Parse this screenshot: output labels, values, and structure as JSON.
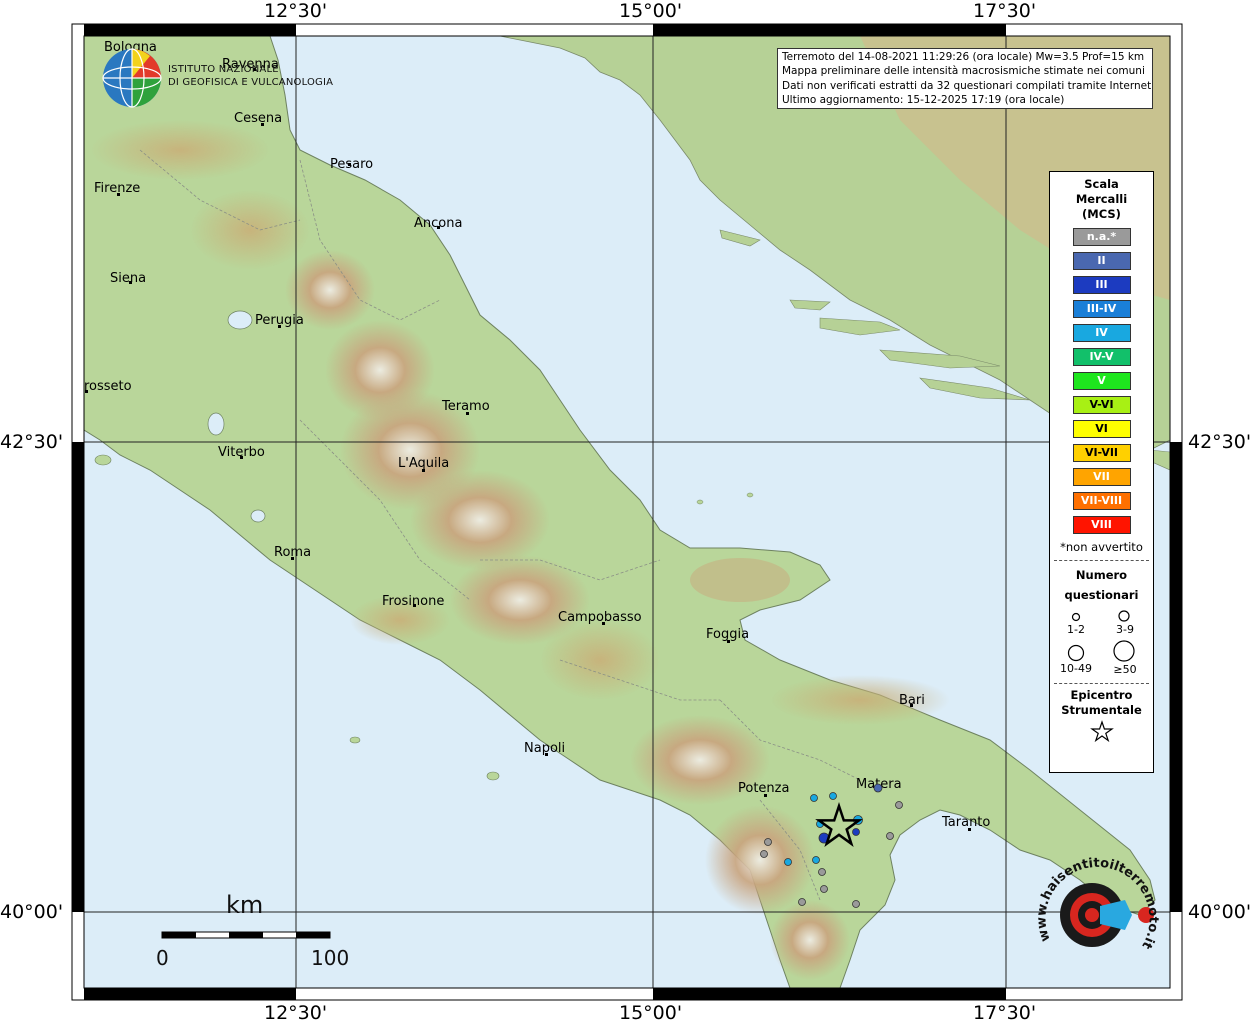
{
  "header_text": {
    "line1": "Terremoto del 14-08-2021 11:29:26 (ora locale) Mw=3.5 Prof=15 km",
    "line2": "Mappa preliminare delle intensità macrosismiche stimate nei comuni",
    "line3": "Dati non verificati estratti da 32 questionari compilati tramite Internet.",
    "line4": "Ultimo aggiornamento: 15-12-2025 17:19 (ora locale)"
  },
  "institution": {
    "line1": "ISTITUTO NAZIONALE",
    "line2": "DI GEOFISICA E VULCANOLOGIA"
  },
  "frame_labels": {
    "top_left": "12°30'",
    "top_mid": "15°00'",
    "top_right": "17°30'",
    "bottom_left": "12°30'",
    "bottom_mid": "15°00'",
    "bottom_right": "17°30'",
    "left_upper": "42°30'",
    "left_lower": "40°00'",
    "right_upper": "42°30'",
    "right_lower": "40°00'"
  },
  "cities": [
    {
      "name": "Bologna"
    },
    {
      "name": "Ravenna"
    },
    {
      "name": "Cesena"
    },
    {
      "name": "Pesaro"
    },
    {
      "name": "Firenze"
    },
    {
      "name": "Ancona"
    },
    {
      "name": "Siena"
    },
    {
      "name": "Perugia"
    },
    {
      "name": "rosseto"
    },
    {
      "name": "Teramo"
    },
    {
      "name": "Viterbo"
    },
    {
      "name": "L'Aquila"
    },
    {
      "name": "Roma"
    },
    {
      "name": "Frosinone"
    },
    {
      "name": "Campobasso"
    },
    {
      "name": "Foggia"
    },
    {
      "name": "Bari"
    },
    {
      "name": "Napoli"
    },
    {
      "name": "Potenza"
    },
    {
      "name": "Matera"
    },
    {
      "name": "Taranto"
    }
  ],
  "scale_bar": {
    "unit": "km",
    "min": "0",
    "max": "100"
  },
  "legend": {
    "title1": "Scala",
    "title2": "Mercalli",
    "title3": "(MCS)",
    "classes": [
      {
        "label": "n.a.*",
        "color": "#9a9a9a"
      },
      {
        "label": "II",
        "color": "#4a68b0"
      },
      {
        "label": "III",
        "color": "#1c3bc0"
      },
      {
        "label": "III-IV",
        "color": "#1a7fd8"
      },
      {
        "label": "IV",
        "color": "#19a8e0"
      },
      {
        "label": "IV-V",
        "color": "#12c06a"
      },
      {
        "label": "V",
        "color": "#1ee61e"
      },
      {
        "label": "V-VI",
        "color": "#a8f014"
      },
      {
        "label": "VI",
        "color": "#ffff00"
      },
      {
        "label": "VI-VII",
        "color": "#ffd000"
      },
      {
        "label": "VII",
        "color": "#ffa400"
      },
      {
        "label": "VII-VIII",
        "color": "#ff7000"
      },
      {
        "label": "VIII",
        "color": "#ff1400"
      }
    ],
    "note": "*non avvertito",
    "count_title1": "Numero",
    "count_title2": "questionari",
    "count_sizes": [
      "1-2",
      "3-9",
      "10-49",
      "≥50"
    ],
    "epi_title1": "Epicentro",
    "epi_title2": "Strumentale"
  },
  "observations": [
    {
      "intensity": "III",
      "color": "#1c3bc0"
    },
    {
      "intensity": "II",
      "color": "#4a68b0"
    },
    {
      "intensity": "IV",
      "color": "#19a8e0"
    },
    {
      "intensity": "IV",
      "color": "#19a8e0"
    },
    {
      "intensity": "IV",
      "color": "#19a8e0"
    },
    {
      "intensity": "IV",
      "color": "#19a8e0"
    },
    {
      "intensity": "IV",
      "color": "#19a8e0"
    },
    {
      "intensity": "IV",
      "color": "#19a8e0"
    },
    {
      "intensity": "III",
      "color": "#1c3bc0"
    },
    {
      "intensity": "n.a.*",
      "color": "#9a9a9a"
    },
    {
      "intensity": "n.a.*",
      "color": "#9a9a9a"
    },
    {
      "intensity": "n.a.*",
      "color": "#9a9a9a"
    },
    {
      "intensity": "n.a.*",
      "color": "#9a9a9a"
    },
    {
      "intensity": "n.a.*",
      "color": "#9a9a9a"
    },
    {
      "intensity": "n.a.*",
      "color": "#9a9a9a"
    },
    {
      "intensity": "n.a.*",
      "color": "#9a9a9a"
    },
    {
      "intensity": "n.a.*",
      "color": "#9a9a9a"
    }
  ],
  "logo_text": "www.haisentitoilterremoto.it",
  "colors": {
    "sea": "#dcedf8",
    "land": "#b9d69a",
    "mountain": "#c7a883"
  }
}
